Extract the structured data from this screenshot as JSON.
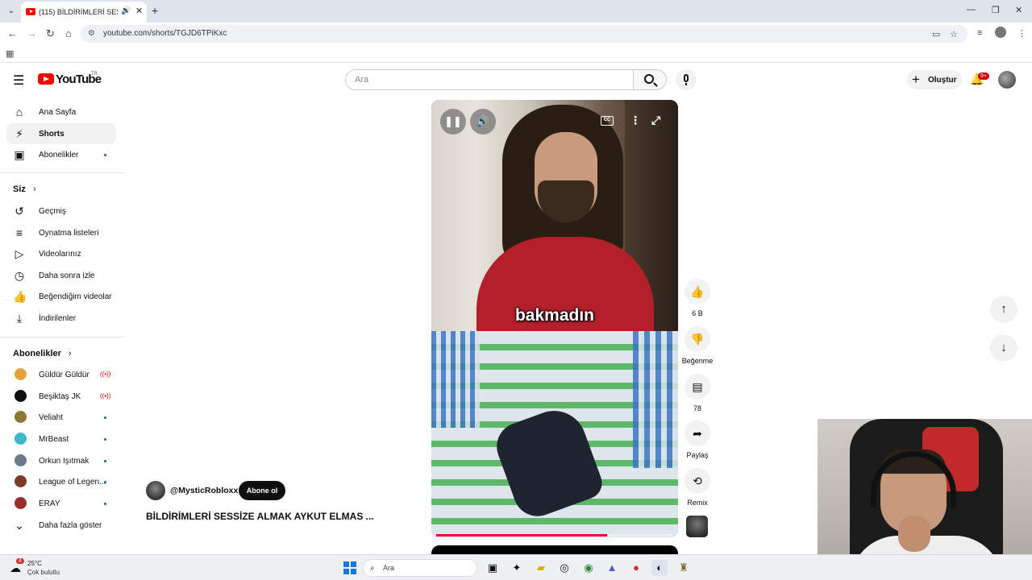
{
  "browser": {
    "tab_title": "(115) BİLDİRİMLERİ SESSİZE ALMAK AYKUT ELMAS",
    "url": "youtube.com/shorts/TGJD6TPiKxc"
  },
  "header": {
    "logo_text": "YouTube",
    "country": "TR",
    "search_placeholder": "Ara",
    "create_label": "Oluştur",
    "notif_badge": "9+"
  },
  "sidebar": {
    "main": [
      {
        "label": "Ana Sayfa",
        "icon": "home-icon"
      },
      {
        "label": "Shorts",
        "icon": "shorts-icon"
      },
      {
        "label": "Abonelikler",
        "icon": "subscriptions-icon"
      }
    ],
    "you_heading": "Siz",
    "you": [
      {
        "label": "Geçmiş",
        "icon": "history-icon"
      },
      {
        "label": "Oynatma listeleri",
        "icon": "playlists-icon"
      },
      {
        "label": "Videolarınız",
        "icon": "your-videos-icon"
      },
      {
        "label": "Daha sonra izle",
        "icon": "watch-later-icon"
      },
      {
        "label": "Beğendiğim videolar",
        "icon": "liked-icon"
      },
      {
        "label": "İndirilenler",
        "icon": "downloads-icon"
      }
    ],
    "subs_heading": "Abonelikler",
    "subscriptions": [
      {
        "label": "Güldür Güldür",
        "status": "live",
        "color": "#e6a23c"
      },
      {
        "label": "Beşiktaş JK",
        "status": "live",
        "color": "#111111"
      },
      {
        "label": "Veliaht",
        "status": "new",
        "color": "#8a7a3a"
      },
      {
        "label": "MrBeast",
        "status": "new",
        "color": "#3fb6c9"
      },
      {
        "label": "Orkun Işıtmak",
        "status": "new",
        "color": "#6c7a8c"
      },
      {
        "label": "League of Legen...",
        "status": "new",
        "color": "#7a3b2a"
      },
      {
        "label": "ERAY",
        "status": "new",
        "color": "#9a2e2e"
      }
    ],
    "show_more": "Daha fazla göster"
  },
  "video": {
    "caption": "bakmadın",
    "progress": 0.72,
    "channel": "@MysticRobloxx",
    "subscribe_label": "Abone ol",
    "title": "BİLDİRİMLERİ SESSİZE ALMAK AYKUT ELMAS ...",
    "cc_label": "CC"
  },
  "actions": {
    "likes": "6 B",
    "dislike": "Beğenme",
    "comments": "78",
    "share": "Paylaş",
    "remix": "Remix"
  },
  "taskbar": {
    "weather_temp": "25°C",
    "weather_desc": "Çok bulutlu",
    "weather_badge": "4",
    "search_label": "Ara"
  }
}
